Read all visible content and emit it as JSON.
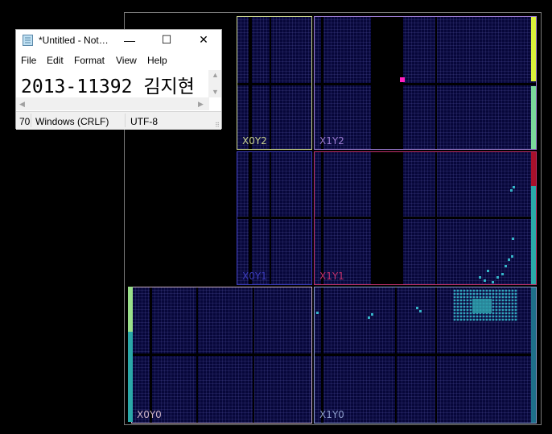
{
  "notepad": {
    "title": "*Untitled - Not…",
    "controls": {
      "minimize": "—",
      "maximize": "☐",
      "close": "✕"
    },
    "menu": [
      "File",
      "Edit",
      "Format",
      "View",
      "Help"
    ],
    "text": "2013-11392 김지현",
    "status": {
      "position": "70",
      "line_ending": "Windows (CRLF)",
      "encoding": "UTF-8"
    }
  },
  "device": {
    "regions": [
      {
        "label": "X0Y2",
        "color": "#c8d28c"
      },
      {
        "label": "X1Y2",
        "color": "#9a7ad0"
      },
      {
        "label": "X0Y1",
        "color": "#3a3ab8"
      },
      {
        "label": "X1Y1",
        "color": "#c0306a"
      },
      {
        "label": "X0Y0",
        "color": "#c9b0c4"
      },
      {
        "label": "X1Y0",
        "color": "#8a9ac8"
      }
    ],
    "highlight_colors": {
      "selected_cell": "#ff1fc0",
      "placed_cells": "#35b5c8",
      "edge_yellow": "#d9f03a",
      "edge_red": "#a8102a",
      "edge_teal": "#2aa8a8"
    }
  }
}
